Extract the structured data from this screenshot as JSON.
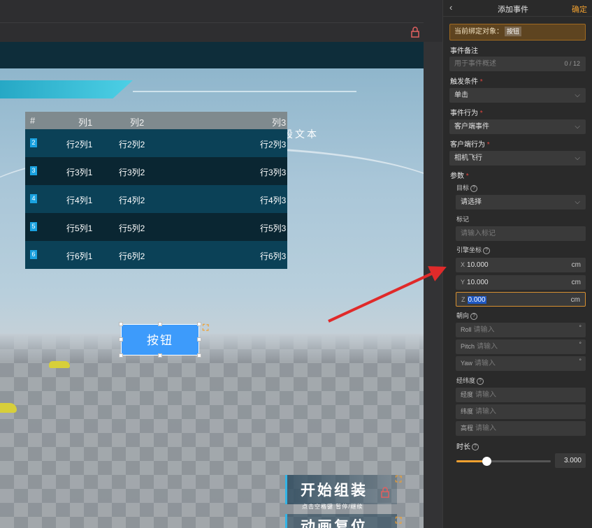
{
  "scene": {
    "background_text": "段文本",
    "table": {
      "headers": [
        "#",
        "列1",
        "列2",
        "列3"
      ],
      "rows": [
        {
          "index": "2",
          "c1": "行2列1",
          "c2": "行2列2",
          "c3": "行2列3"
        },
        {
          "index": "3",
          "c1": "行3列1",
          "c2": "行3列2",
          "c3": "行3列3"
        },
        {
          "index": "4",
          "c1": "行4列1",
          "c2": "行4列2",
          "c3": "行4列3"
        },
        {
          "index": "5",
          "c1": "行5列1",
          "c2": "行5列2",
          "c3": "行5列3"
        },
        {
          "index": "6",
          "c1": "行6列1",
          "c2": "行6列2",
          "c3": "行6列3"
        }
      ]
    },
    "button_label": "按钮",
    "start_title": "开始组装",
    "start_subtitle": "点击空格键 暂停/继续",
    "anim_title": "动画复位"
  },
  "panel": {
    "title": "添加事件",
    "confirm": "确定",
    "bound_label": "当前绑定对象：",
    "bound_tag": "按钮",
    "remark_label": "事件备注",
    "remark_placeholder": "用于事件概述",
    "remark_count": "0 / 12",
    "trigger_label": "触发条件",
    "trigger_value": "单击",
    "behavior_label": "事件行为",
    "behavior_value": "客户端事件",
    "client_behavior_label": "客户端行为",
    "client_behavior_value": "相机飞行",
    "params_label": "参数",
    "target_label": "目标",
    "target_value": "请选择",
    "mark_label": "标记",
    "mark_placeholder": "请输入标记",
    "engine_coord_label": "引擎坐标",
    "x_axis": "X",
    "x_value": "10.000",
    "y_axis": "Y",
    "y_value": "10.000",
    "z_axis": "Z",
    "z_value": "0.000",
    "unit": "cm",
    "orientation_label": "朝向",
    "roll_label": "Roll",
    "pitch_label": "Pitch",
    "yaw_label": "Yaw",
    "input_placeholder": "请输入",
    "degree": "°",
    "lonlat_label": "经纬度",
    "lon_label": "经度",
    "lat_label": "纬度",
    "alt_label": "高程",
    "duration_label": "时长",
    "duration_value": "3.000",
    "duration_slider_fraction": 0.32,
    "required_mark": "*",
    "help": "?"
  },
  "colors": {
    "accent": "#f0a030",
    "button_blue": "#3d9bfb",
    "annotation_red": "#e02a2a"
  }
}
